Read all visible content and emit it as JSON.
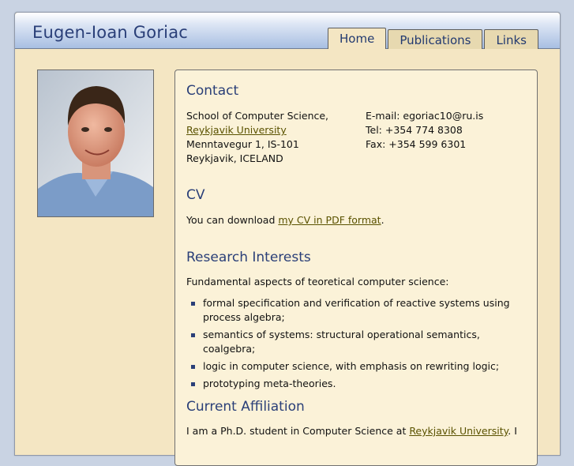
{
  "site": {
    "title": "Eugen-Ioan Goriac",
    "tabs": [
      {
        "label": "Home",
        "active": true
      },
      {
        "label": "Publications",
        "active": false
      },
      {
        "label": "Links",
        "active": false
      }
    ]
  },
  "contact": {
    "heading": "Contact",
    "address_line1": "School of Computer Science,",
    "university_link": "Reykjavik University",
    "address_line3": "Menntavegur 1, IS-101",
    "address_line4": "Reykjavik, ICELAND",
    "email": "E-mail: egoriac10@ru.is",
    "tel": "Tel: +354 774 8308",
    "fax": "Fax: +354 599 6301"
  },
  "cv": {
    "heading": "CV",
    "text_before": "You can download ",
    "link": "my CV in PDF format",
    "text_after": "."
  },
  "research": {
    "heading": "Research Interests",
    "intro": "Fundamental aspects of teoretical computer science:",
    "items": [
      "formal specification and verification of reactive systems using process algebra;",
      "semantics of systems: structural operational semantics, coalgebra;",
      "logic in computer science, with emphasis on rewriting logic;",
      "prototyping meta-theories."
    ]
  },
  "affiliation": {
    "heading": "Current Affiliation",
    "text_before": "I am a Ph.D. student in Computer Science at ",
    "link": "Reykjavik University",
    "text_after": ". I"
  },
  "colors": {
    "page_bg": "#f4e6c3",
    "accent": "#2a3f78",
    "link": "#5a5200"
  }
}
